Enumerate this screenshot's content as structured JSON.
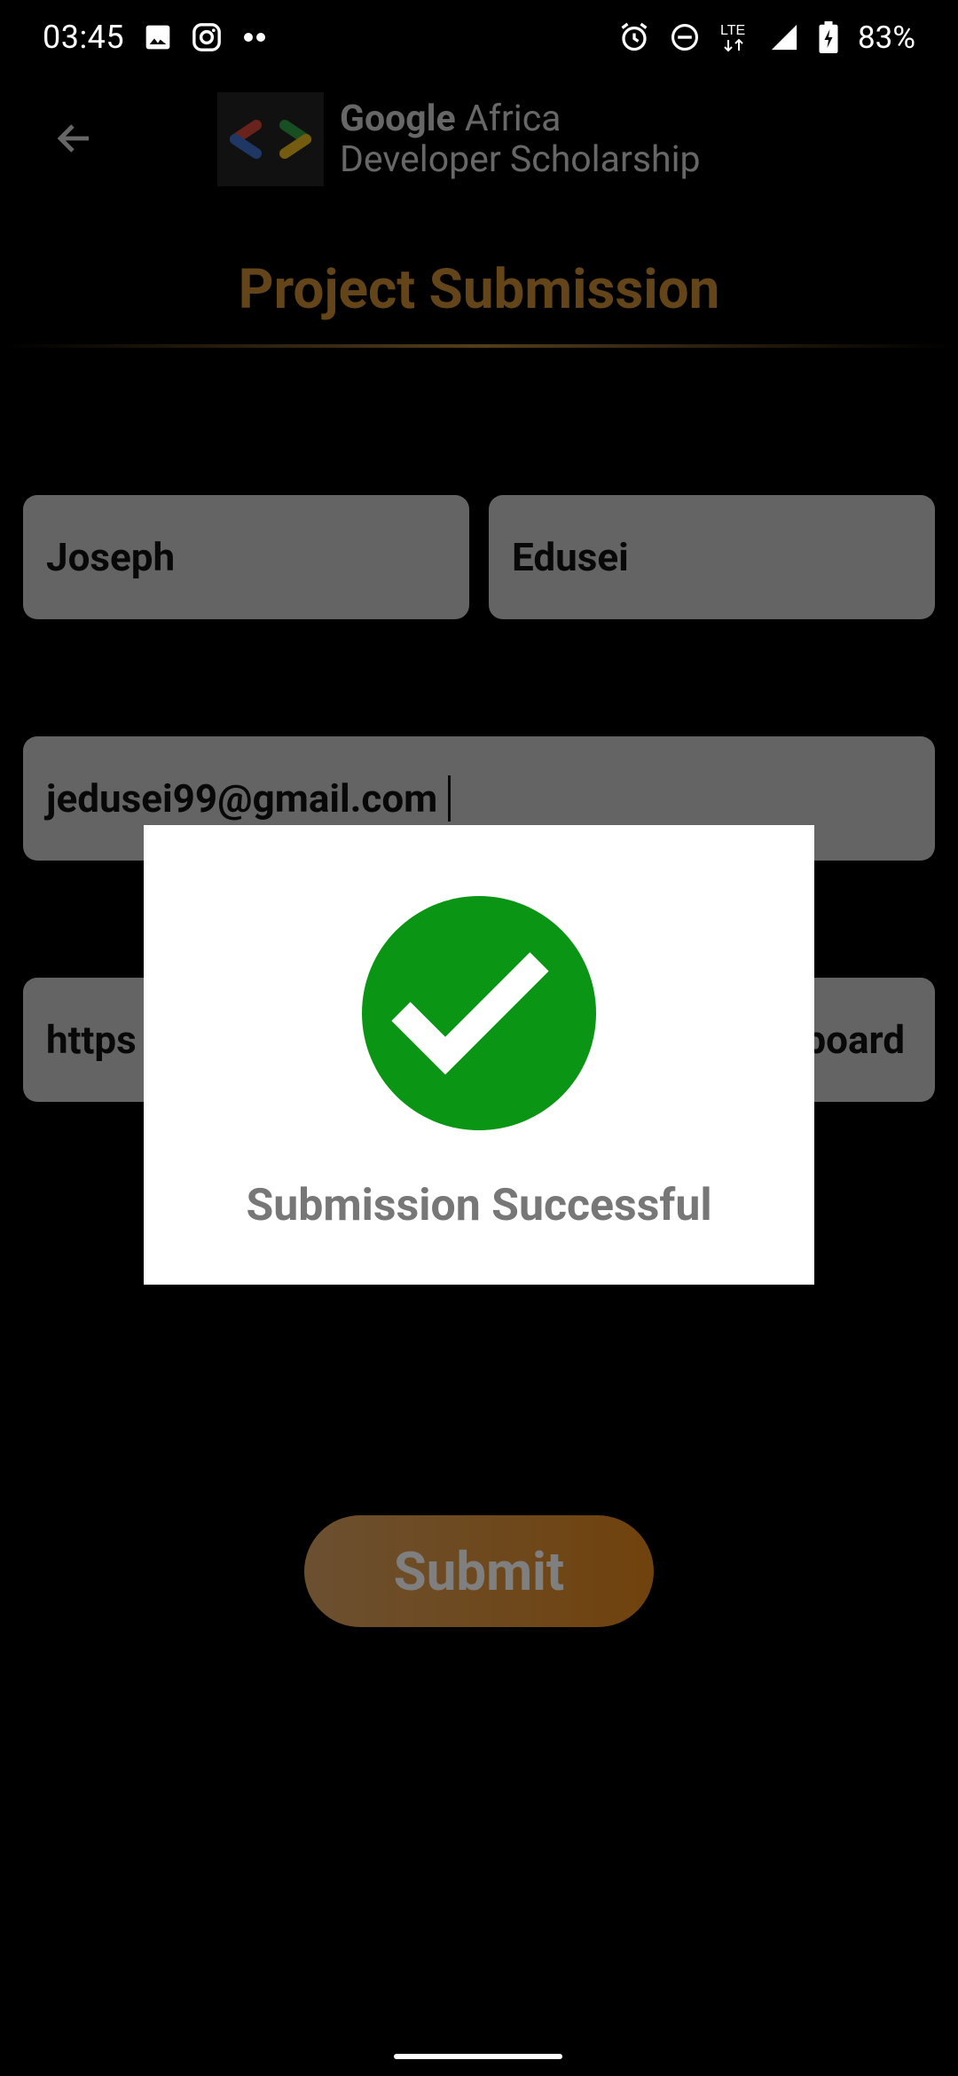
{
  "status_bar": {
    "time": "03:45",
    "battery": "83%",
    "network": "LTE",
    "icons_left": [
      "image-icon",
      "instagram-icon",
      "more-dots-icon"
    ],
    "icons_right": [
      "alarm-icon",
      "dnd-icon",
      "lte-icon",
      "signal-icon",
      "battery-charging-icon"
    ]
  },
  "toolbar": {
    "logo_line1_bold": "Google",
    "logo_line1_rest": " Africa",
    "logo_line2": "Developer Scholarship"
  },
  "page": {
    "title": "Project Submission"
  },
  "form": {
    "first_name": "Joseph",
    "last_name": "Edusei",
    "email": "jedusei99@gmail.com",
    "link_start": "https",
    "link_end": "board",
    "submit_label": "Submit"
  },
  "dialog": {
    "message": "Submission Successful",
    "icon": "check-circle-icon"
  },
  "colors": {
    "accent": "#c88a32",
    "success": "#0a9514",
    "submit_start": "#d7a062",
    "submit_end": "#e1851a"
  }
}
